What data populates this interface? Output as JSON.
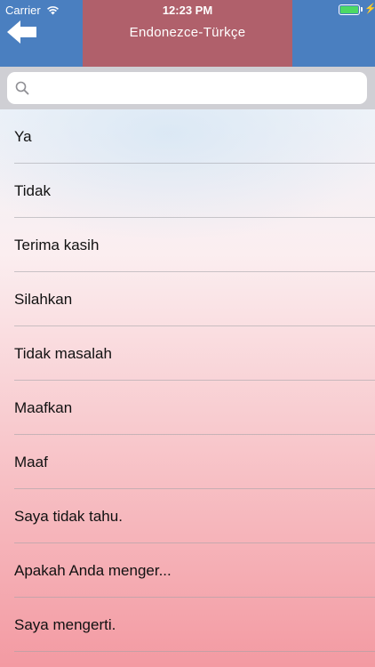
{
  "status_bar": {
    "carrier": "Carrier",
    "time": "12:23 PM"
  },
  "header": {
    "title": "Endonezce-Türkçe",
    "back_icon": "arrow-left-icon",
    "colors": {
      "bar": "#4a7fc0",
      "title_panel": "#b0606b"
    }
  },
  "search": {
    "placeholder": "",
    "value": ""
  },
  "list": {
    "items": [
      {
        "label": "Ya"
      },
      {
        "label": "Tidak"
      },
      {
        "label": "Terima kasih"
      },
      {
        "label": "Silahkan"
      },
      {
        "label": "Tidak masalah"
      },
      {
        "label": "Maafkan"
      },
      {
        "label": "Maaf"
      },
      {
        "label": "Saya tidak tahu."
      },
      {
        "label": "Apakah Anda menger..."
      },
      {
        "label": "Saya mengerti."
      }
    ]
  }
}
